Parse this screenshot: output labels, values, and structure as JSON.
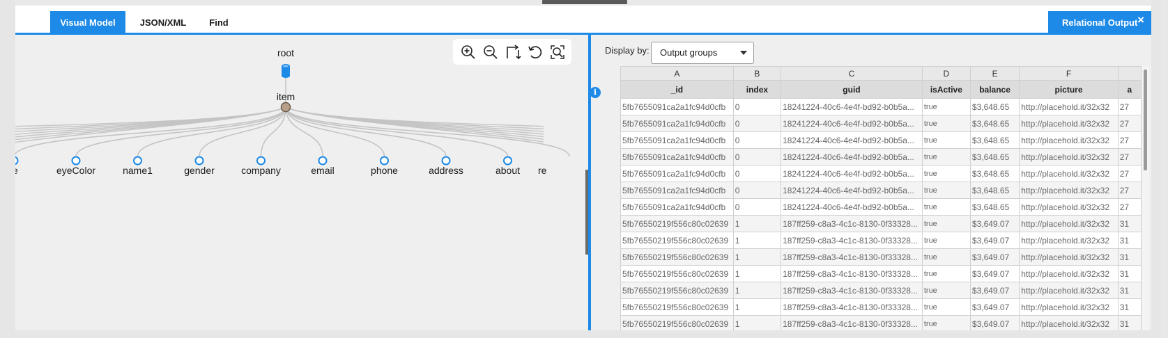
{
  "tabs": {
    "visual_model": "Visual Model",
    "json_xml": "JSON/XML",
    "find": "Find",
    "relational_output": "Relational Output",
    "close_symbol": "×"
  },
  "tree": {
    "root_label": "root",
    "item_label": "item",
    "left_cut_label": "e",
    "right_cut_label": "re",
    "children": [
      "eyeColor",
      "name1",
      "gender",
      "company",
      "email",
      "phone",
      "address",
      "about"
    ]
  },
  "zoom_toolbar": {
    "icons": [
      "zoom-in-icon",
      "zoom-out-icon",
      "orthogonal-links-icon",
      "reset-icon",
      "zoom-to-fit-icon"
    ]
  },
  "relational": {
    "display_by_label": "Display by:",
    "display_by_value": "Output groups",
    "info_symbol": "i",
    "column_letters": [
      "A",
      "B",
      "C",
      "D",
      "E",
      "F",
      ""
    ],
    "column_names": [
      "_id",
      "index",
      "guid",
      "isActive",
      "balance",
      "picture",
      "a"
    ],
    "rows": [
      [
        "5fb7655091ca2a1fc94d0cfb",
        "0",
        "18241224-40c6-4e4f-bd92-b0b5a...",
        "true",
        "$3,648.65",
        "http://placehold.it/32x32",
        "27"
      ],
      [
        "5fb7655091ca2a1fc94d0cfb",
        "0",
        "18241224-40c6-4e4f-bd92-b0b5a...",
        "true",
        "$3,648.65",
        "http://placehold.it/32x32",
        "27"
      ],
      [
        "5fb7655091ca2a1fc94d0cfb",
        "0",
        "18241224-40c6-4e4f-bd92-b0b5a...",
        "true",
        "$3,648.65",
        "http://placehold.it/32x32",
        "27"
      ],
      [
        "5fb7655091ca2a1fc94d0cfb",
        "0",
        "18241224-40c6-4e4f-bd92-b0b5a...",
        "true",
        "$3,648.65",
        "http://placehold.it/32x32",
        "27"
      ],
      [
        "5fb7655091ca2a1fc94d0cfb",
        "0",
        "18241224-40c6-4e4f-bd92-b0b5a...",
        "true",
        "$3,648.65",
        "http://placehold.it/32x32",
        "27"
      ],
      [
        "5fb7655091ca2a1fc94d0cfb",
        "0",
        "18241224-40c6-4e4f-bd92-b0b5a...",
        "true",
        "$3,648.65",
        "http://placehold.it/32x32",
        "27"
      ],
      [
        "5fb7655091ca2a1fc94d0cfb",
        "0",
        "18241224-40c6-4e4f-bd92-b0b5a...",
        "true",
        "$3,648.65",
        "http://placehold.it/32x32",
        "27"
      ],
      [
        "5fb76550219f556c80c02639",
        "1",
        "187ff259-c8a3-4c1c-8130-0f33328...",
        "true",
        "$3,649.07",
        "http://placehold.it/32x32",
        "31"
      ],
      [
        "5fb76550219f556c80c02639",
        "1",
        "187ff259-c8a3-4c1c-8130-0f33328...",
        "true",
        "$3,649.07",
        "http://placehold.it/32x32",
        "31"
      ],
      [
        "5fb76550219f556c80c02639",
        "1",
        "187ff259-c8a3-4c1c-8130-0f33328...",
        "true",
        "$3,649.07",
        "http://placehold.it/32x32",
        "31"
      ],
      [
        "5fb76550219f556c80c02639",
        "1",
        "187ff259-c8a3-4c1c-8130-0f33328...",
        "true",
        "$3,649.07",
        "http://placehold.it/32x32",
        "31"
      ],
      [
        "5fb76550219f556c80c02639",
        "1",
        "187ff259-c8a3-4c1c-8130-0f33328...",
        "true",
        "$3,649.07",
        "http://placehold.it/32x32",
        "31"
      ],
      [
        "5fb76550219f556c80c02639",
        "1",
        "187ff259-c8a3-4c1c-8130-0f33328...",
        "true",
        "$3,649.07",
        "http://placehold.it/32x32",
        "31"
      ],
      [
        "5fb76550219f556c80c02639",
        "1",
        "187ff259-c8a3-4c1c-8130-0f33328...",
        "true",
        "$3,649.07",
        "http://placehold.it/32x32",
        "31"
      ]
    ]
  },
  "colors": {
    "accent": "#1d8ae8",
    "node_root": "#1d8ae8",
    "node_item": "#b9a08a",
    "link": "#c4c4c4"
  }
}
